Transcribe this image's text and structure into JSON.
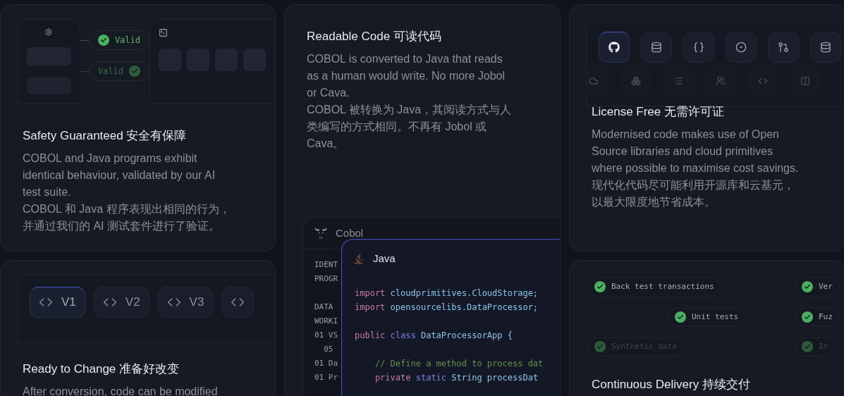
{
  "safety": {
    "flow": [
      {
        "label": "Valid",
        "dimmed": false
      },
      {
        "label": "Valid",
        "dimmed": true
      }
    ],
    "title": "Safety Guaranteed 安全有保障",
    "body": [
      "COBOL and Java programs exhibit identical behaviour, validated by our AI test suite.",
      "COBOL 和 Java 程序表现出相同的行为，并通过我们的 AI 测试套件进行了验证。"
    ]
  },
  "readable": {
    "title": "Readable Code 可读代码",
    "body": [
      "COBOL is converted to Java that reads as a human would write. No more Jobol or Cava.",
      "COBOL 被转换为 Java，其阅读方式与人类编写的方式相同。不再有 Jobol 或 Cava。"
    ],
    "cobol": {
      "title": "Cobol",
      "lines": [
        {
          "text": "IDENT",
          "gap_before": false
        },
        {
          "text": "PROGR",
          "gap_before": false
        },
        {
          "text": "DATA",
          "gap_before": true
        },
        {
          "text": "WORKI",
          "gap_before": false
        },
        {
          "text": "01 VS",
          "gap_before": false
        },
        {
          "text": "  05",
          "gap_before": false
        },
        {
          "text": "01 Da",
          "gap_before": false
        },
        {
          "text": "01 Pr",
          "gap_before": false
        }
      ]
    },
    "java": {
      "title": "Java",
      "lines": [
        {
          "gap_before": false,
          "tokens": [
            {
              "kind": "keyword",
              "text": "import"
            },
            {
              "kind": "plain",
              "text": " cloudprimitives.CloudStorage;"
            }
          ]
        },
        {
          "gap_before": false,
          "tokens": [
            {
              "kind": "keyword",
              "text": "import"
            },
            {
              "kind": "plain",
              "text": " opensourcelibs.DataProcessor;"
            }
          ]
        },
        {
          "gap_before": true,
          "tokens": [
            {
              "kind": "keyword",
              "text": "public"
            },
            {
              "kind": "type",
              "text": " class"
            },
            {
              "kind": "plain",
              "text": " DataProcessorApp {"
            }
          ]
        },
        {
          "gap_before": true,
          "tokens": [
            {
              "kind": "comment",
              "text": "    // Define a method to process dat"
            }
          ]
        },
        {
          "gap_before": false,
          "tokens": [
            {
              "kind": "keyword",
              "text": "    private"
            },
            {
              "kind": "type",
              "text": " static"
            },
            {
              "kind": "plain",
              "text": " String processDat"
            }
          ]
        }
      ]
    }
  },
  "license": {
    "tiles": [
      {
        "selected": true
      },
      {
        "selected": false
      },
      {
        "selected": false
      },
      {
        "selected": false
      },
      {
        "selected": false
      },
      {
        "selected": false
      }
    ],
    "title": "License Free 无需许可证",
    "body": [
      "Modernised code makes use of Open Source libraries and cloud primitives where possible to maximise cost savings.",
      "现代化代码尽可能利用开源库和云基元，以最大限度地节省成本。"
    ]
  },
  "change": {
    "versions": [
      {
        "label": "V1",
        "selected": true
      },
      {
        "label": "V2",
        "selected": false
      },
      {
        "label": "V3",
        "selected": false
      },
      {
        "selected": false
      }
    ],
    "title": "Ready to Change 准备好改变",
    "body": [
      "After conversion, code can be modified"
    ]
  },
  "delivery": {
    "checks": [
      {
        "label": "Back test transactions",
        "dimmed": false
      },
      {
        "label": "Unit tests",
        "dimmed": false
      },
      {
        "label": "Synthetic data",
        "dimmed": true
      },
      {
        "label": "Ver",
        "dimmed": false
      },
      {
        "label": "Fuz",
        "dimmed": false
      },
      {
        "label": "In",
        "dimmed": true
      }
    ],
    "title": "Continuous Delivery 持续交付"
  }
}
